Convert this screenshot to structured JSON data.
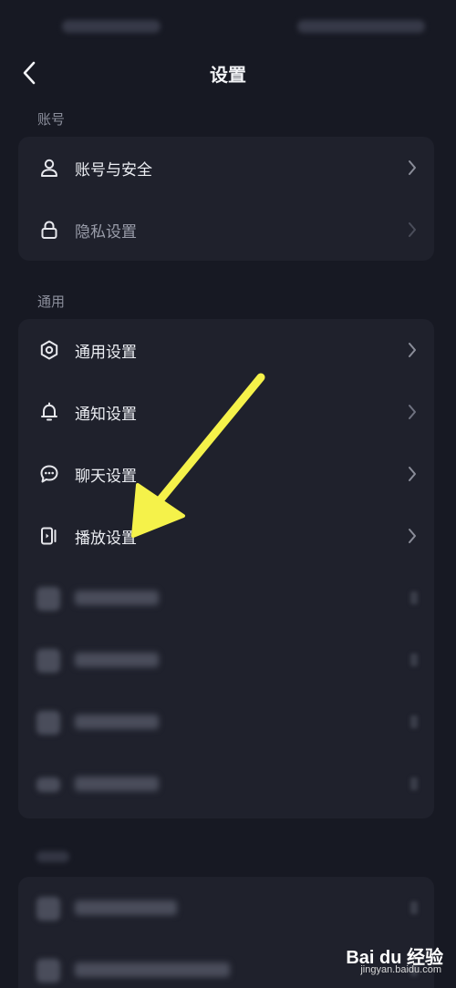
{
  "header": {
    "title": "设置",
    "back_icon": "chevron-left-icon"
  },
  "sections": [
    {
      "label": "账号",
      "items": [
        {
          "label": "账号与安全",
          "icon": "user-icon",
          "dim": false
        },
        {
          "label": "隐私设置",
          "icon": "lock-icon",
          "dim": true
        }
      ]
    },
    {
      "label": "通用",
      "items": [
        {
          "label": "通用设置",
          "icon": "gear-icon",
          "dim": false
        },
        {
          "label": "通知设置",
          "icon": "bell-icon",
          "dim": false
        },
        {
          "label": "聊天设置",
          "icon": "chat-bubble-icon",
          "dim": false
        },
        {
          "label": "播放设置",
          "icon": "play-device-icon",
          "dim": false
        }
      ]
    }
  ],
  "annotation": {
    "arrow_color": "#f5f24a",
    "points_to": "播放设置"
  },
  "watermark": {
    "brand": "Bai du 经验",
    "url": "jingyan.baidu.com"
  },
  "colors": {
    "background": "#171923",
    "card": "#1f212c",
    "text": "#eceef3",
    "muted": "#8b8e9b"
  }
}
